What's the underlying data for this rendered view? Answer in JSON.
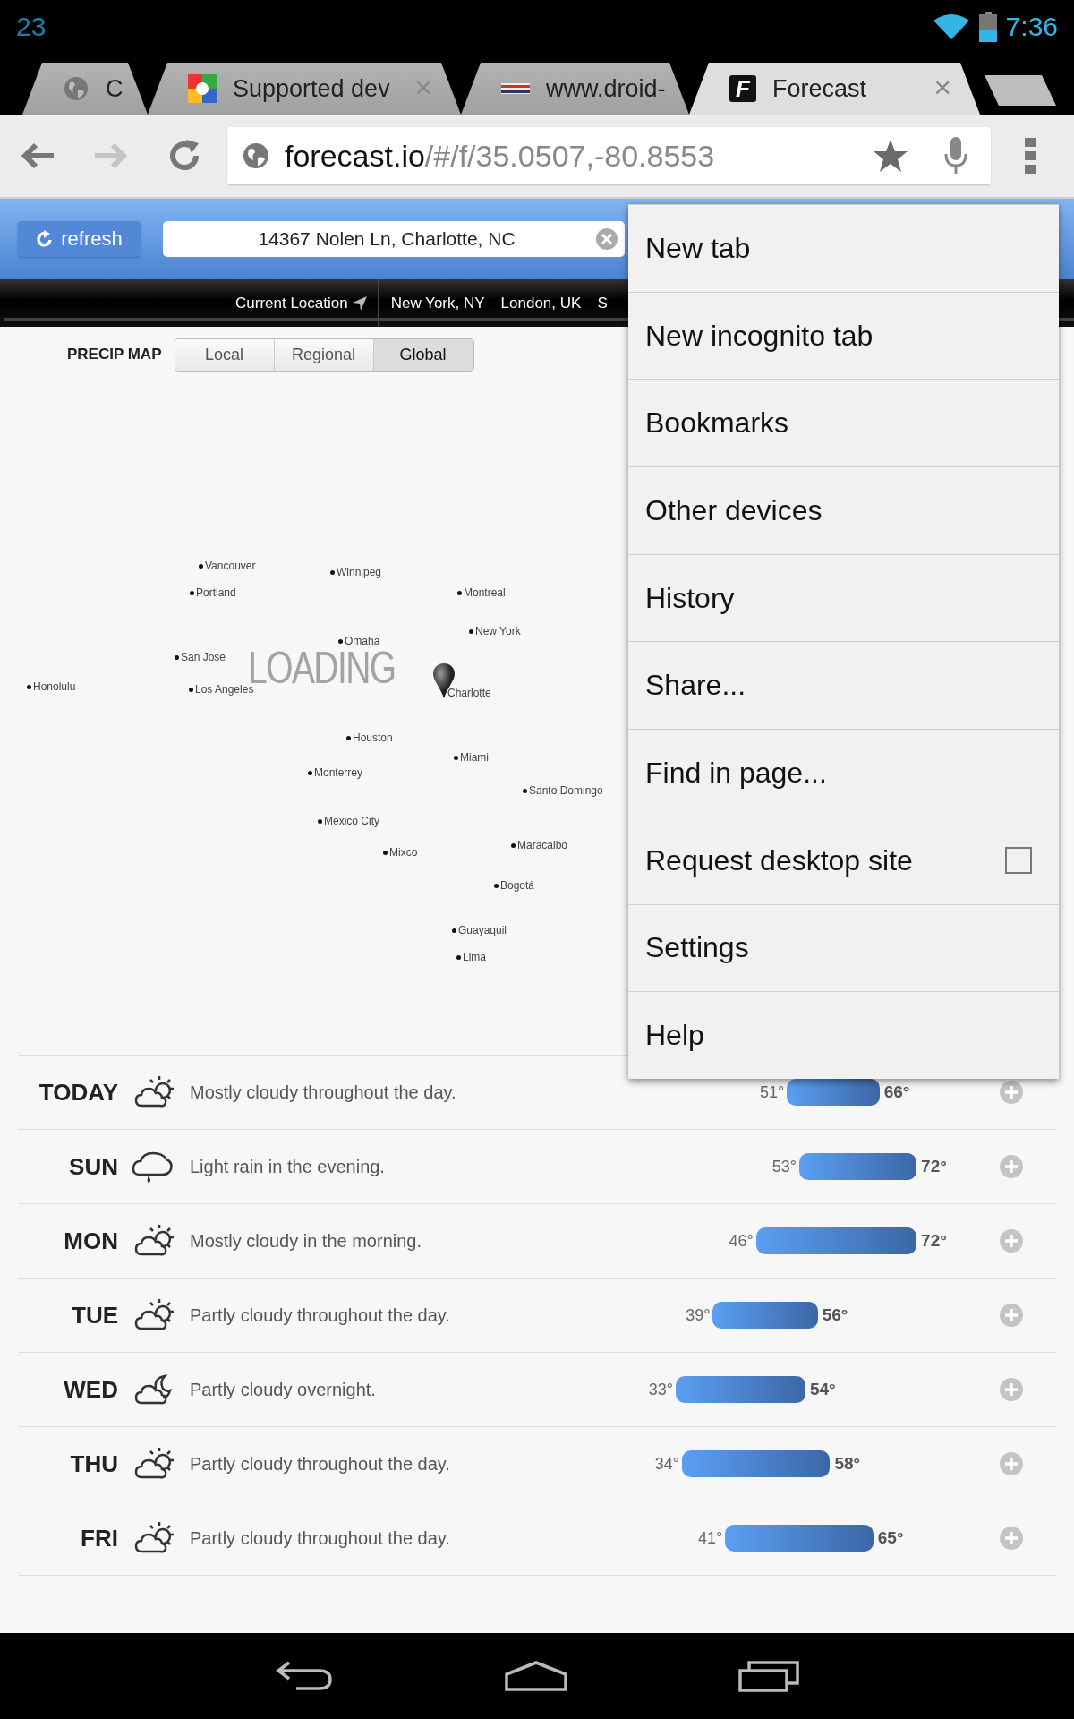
{
  "status_bar": {
    "notification": "23",
    "time": "7:36"
  },
  "tabs": [
    {
      "title": "C",
      "kind": "globe",
      "selected": false
    },
    {
      "title": "Supported dev",
      "kind": "google",
      "selected": false,
      "close": "×"
    },
    {
      "title": "www.droid-",
      "kind": "flag",
      "selected": false
    },
    {
      "title": "Forecast",
      "kind": "letter",
      "favicon_text": "F",
      "selected": true,
      "close": "×"
    }
  ],
  "toolbar": {
    "url_host": "forecast.io",
    "url_path": "/#/f/35.0507,-80.8553",
    "forward_disabled": true
  },
  "site": {
    "refresh_label": "refresh",
    "location": "14367 Nolen Ln, Charlotte, NC",
    "nav": [
      {
        "label": "Current Location",
        "kind": "current"
      },
      {
        "label": "New York, NY",
        "kind": "city"
      },
      {
        "label": "London, UK",
        "kind": "city"
      },
      {
        "label": "S",
        "kind": "city"
      }
    ]
  },
  "precip_map": {
    "label": "PRECIP MAP",
    "loading": "LOADING",
    "modes": [
      {
        "label": "Local",
        "selected": false
      },
      {
        "label": "Regional",
        "selected": false
      },
      {
        "label": "Global",
        "selected": true
      }
    ],
    "cities": [
      {
        "name": "Vancouver",
        "kind": "dot"
      },
      {
        "name": "Winnipeg",
        "kind": "dot"
      },
      {
        "name": "Portland",
        "kind": "dot"
      },
      {
        "name": "Montreal",
        "kind": "dot"
      },
      {
        "name": "New York",
        "kind": "dot"
      },
      {
        "name": "Omaha",
        "kind": "dot"
      },
      {
        "name": "San Jose",
        "kind": "dot"
      },
      {
        "name": "Honolulu",
        "kind": "dot"
      },
      {
        "name": "Los Angeles",
        "kind": "dot"
      },
      {
        "name": "Charlotte",
        "kind": "pin"
      },
      {
        "name": "Houston",
        "kind": "dot"
      },
      {
        "name": "Miami",
        "kind": "dot"
      },
      {
        "name": "Monterrey",
        "kind": "dot"
      },
      {
        "name": "Santo Domingo",
        "kind": "dot"
      },
      {
        "name": "Mexico City",
        "kind": "dot"
      },
      {
        "name": "Mixco",
        "kind": "dot"
      },
      {
        "name": "Maracaibo",
        "kind": "dot"
      },
      {
        "name": "Bogotá",
        "kind": "dot"
      },
      {
        "name": "Guayaquil",
        "kind": "dot"
      },
      {
        "name": "Lima",
        "kind": "dot"
      }
    ]
  },
  "forecast": [
    {
      "day": "TODAY",
      "kind": "sun-cloud",
      "summary": "Mostly cloudy throughout the day.",
      "low": "51°",
      "high": "66°"
    },
    {
      "day": "SUN",
      "kind": "rain",
      "summary": "Light rain in the evening.",
      "low": "53°",
      "high": "72°"
    },
    {
      "day": "MON",
      "kind": "sun-cloud",
      "summary": "Mostly cloudy in the morning.",
      "low": "46°",
      "high": "72°"
    },
    {
      "day": "TUE",
      "kind": "sun-cloud",
      "summary": "Partly cloudy throughout the day.",
      "low": "39°",
      "high": "56°"
    },
    {
      "day": "WED",
      "kind": "moon-cloud",
      "summary": "Partly cloudy overnight.",
      "low": "33°",
      "high": "54°"
    },
    {
      "day": "THU",
      "kind": "sun-cloud",
      "summary": "Partly cloudy throughout the day.",
      "low": "34°",
      "high": "58°"
    },
    {
      "day": "FRI",
      "kind": "sun-cloud",
      "summary": "Partly cloudy throughout the day.",
      "low": "41°",
      "high": "65°"
    }
  ],
  "menu": [
    {
      "label": "New tab",
      "kind": "item"
    },
    {
      "label": "New incognito tab",
      "kind": "item"
    },
    {
      "label": "Bookmarks",
      "kind": "item"
    },
    {
      "label": "Other devices",
      "kind": "item"
    },
    {
      "label": "History",
      "kind": "item"
    },
    {
      "label": "Share...",
      "kind": "item"
    },
    {
      "label": "Find in page...",
      "kind": "item"
    },
    {
      "label": "Request desktop site",
      "kind": "checkbox",
      "checked": false
    },
    {
      "label": "Settings",
      "kind": "item"
    },
    {
      "label": "Help",
      "kind": "item"
    }
  ]
}
